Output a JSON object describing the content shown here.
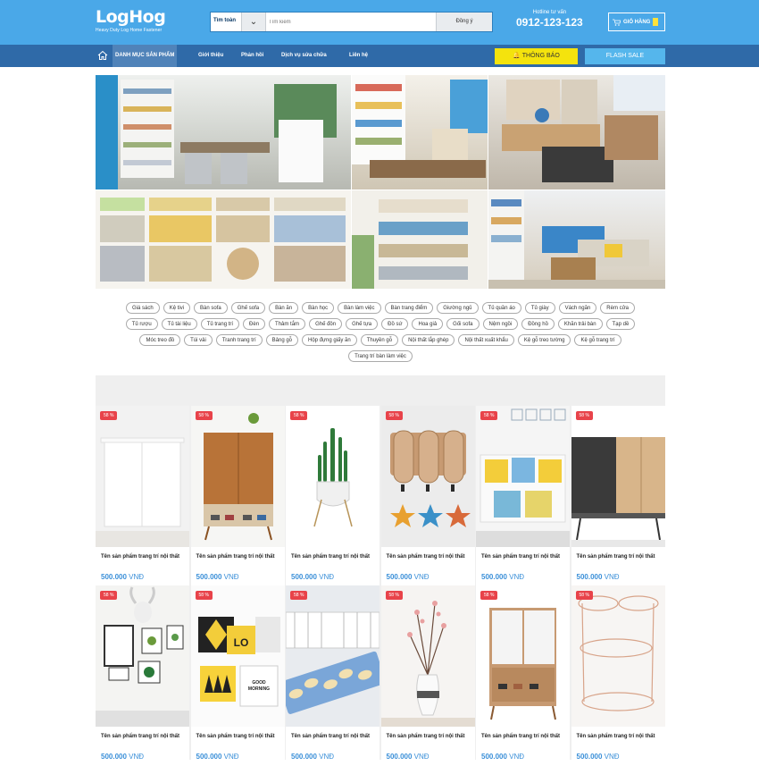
{
  "header": {
    "logo": "LogHog",
    "tagline": "Heavy Duty Log Home Fastener",
    "search": {
      "category": "Tìm toàn",
      "placeholder": "Tìm kiếm",
      "button": "Đồng ý"
    },
    "hotline": {
      "label": "Hotline tư vấn",
      "number": "0912-123-123"
    },
    "cart": {
      "label": "GIỎ HÀNG"
    }
  },
  "nav": {
    "items": [
      "DANH MỤC SẢN PHẨM",
      "Giới thiệu",
      "Phản hồi",
      "Dịch vụ sửa chữa",
      "Liên hệ"
    ],
    "notice_button": "THÔNG BÁO",
    "flash_button": "FLASH SALE"
  },
  "tags": [
    "Giá sách",
    "Kệ tivi",
    "Bàn sofa",
    "Ghế sofa",
    "Bàn ăn",
    "Bàn học",
    "Bàn làm việc",
    "Bàn trang điểm",
    "Giường ngủ",
    "Tủ quần áo",
    "Tủ giày",
    "Vách ngăn",
    "Rèm cửa",
    "Tủ rượu",
    "Tủ tài liệu",
    "Tủ trang trí",
    "Đèn",
    "Thảm tắm",
    "Ghế đôn",
    "Ghế tựa",
    "Đồ sứ",
    "Hoa giả",
    "Gối sofa",
    "Nệm ngồi",
    "Đồng hồ",
    "Khăn trải bàn",
    "Tạp dề",
    "Móc treo đồ",
    "Túi vải",
    "Tranh trang trí",
    "Bảng gỗ",
    "Hộp đựng giấy ăn",
    "Thuyền gỗ",
    "Nội thất lắp ghép",
    "Nội thất xuất khẩu",
    "Kệ gỗ treo tường",
    "Kệ gỗ trang trí",
    "Trang trí bàn làm việc"
  ],
  "products": [
    {
      "badge": "58 %",
      "name": "Tên sản phẩm trang trí nội thất",
      "price": "500.000",
      "currency": "VNĐ",
      "image": "white-shoe-cabinet"
    },
    {
      "badge": "58 %",
      "name": "Tên sản phẩm trang trí nội thất",
      "price": "500.000",
      "currency": "VNĐ",
      "image": "wood-cabinet"
    },
    {
      "badge": "58 %",
      "name": "Tên sản phẩm trang trí nội thất",
      "price": "500.000",
      "currency": "VNĐ",
      "image": "potted-plant"
    },
    {
      "badge": "58 %",
      "name": "Tên sản phẩm trang trí nội thất",
      "price": "500.000",
      "currency": "VNĐ",
      "image": "wall-hooks"
    },
    {
      "badge": "58 %",
      "name": "Tên sản phẩm trang trí nội thất",
      "price": "500.000",
      "currency": "VNĐ",
      "image": "cushions-sofa"
    },
    {
      "badge": "58 %",
      "name": "Tên sản phẩm trang trí nội thất",
      "price": "500.000",
      "currency": "VNĐ",
      "image": "sideboard"
    },
    {
      "badge": "58 %",
      "name": "Tên sản phẩm trang trí nội thất",
      "price": "500.000",
      "currency": "VNĐ",
      "image": "wall-frames"
    },
    {
      "badge": "58 %",
      "name": "Tên sản phẩm trang trí nội thất",
      "price": "500.000",
      "currency": "VNĐ",
      "image": "love-pillows"
    },
    {
      "badge": "58 %",
      "name": "Tên sản phẩm trang trí nội thất",
      "price": "500.000",
      "currency": "VNĐ",
      "image": "fish-mats"
    },
    {
      "badge": "58 %",
      "name": "Tên sản phẩm trang trí nội thất",
      "price": "500.000",
      "currency": "VNĐ",
      "image": "flower-vase"
    },
    {
      "badge": "58 %",
      "name": "Tên sản phẩm trang trí nội thất",
      "price": "500.000",
      "currency": "VNĐ",
      "image": "white-cabinet"
    },
    {
      "badge": "58 %",
      "name": "Tên sản phẩm trang trí nội thất",
      "price": "500.000",
      "currency": "VNĐ",
      "image": "copper-rack"
    }
  ]
}
